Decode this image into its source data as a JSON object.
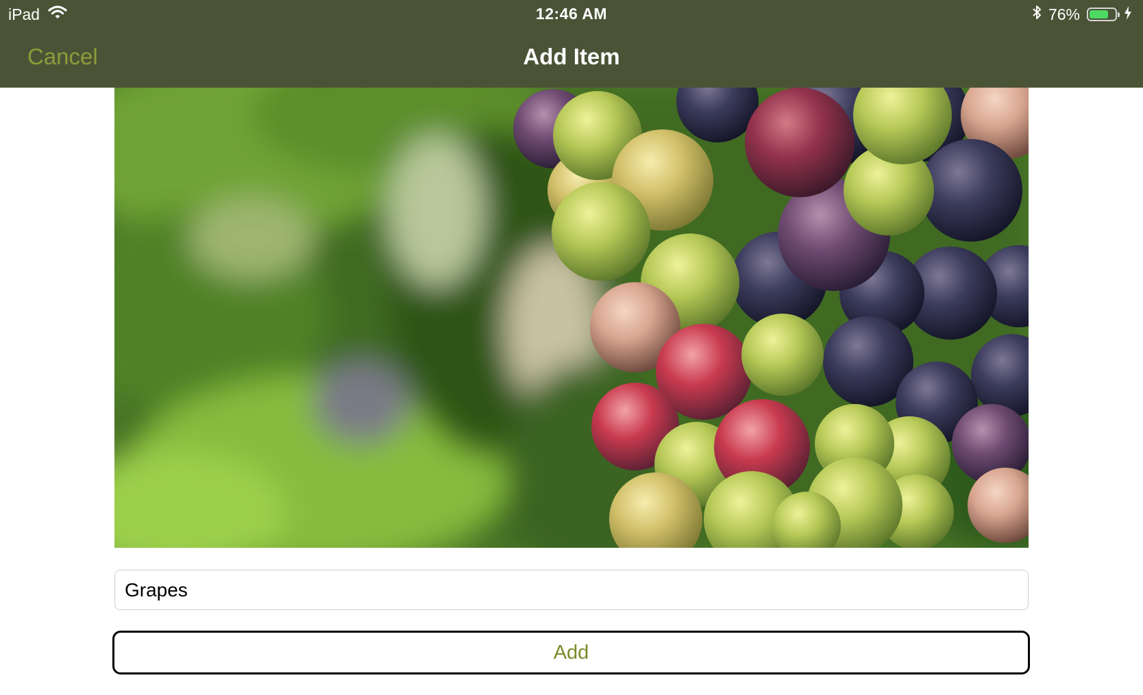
{
  "status_bar": {
    "device": "iPad",
    "time": "12:46 AM",
    "battery_percent_label": "76%",
    "battery_level": 0.76,
    "icons": [
      "wifi-icon",
      "bluetooth-icon",
      "battery-icon",
      "charging-bolt-icon"
    ]
  },
  "nav": {
    "cancel_label": "Cancel",
    "title": "Add Item"
  },
  "form": {
    "name_value": "Grapes",
    "add_label": "Add"
  },
  "colors": {
    "bar_background": "#4b5337",
    "accent": "#8e9c39",
    "battery_fill": "#4cd964"
  }
}
